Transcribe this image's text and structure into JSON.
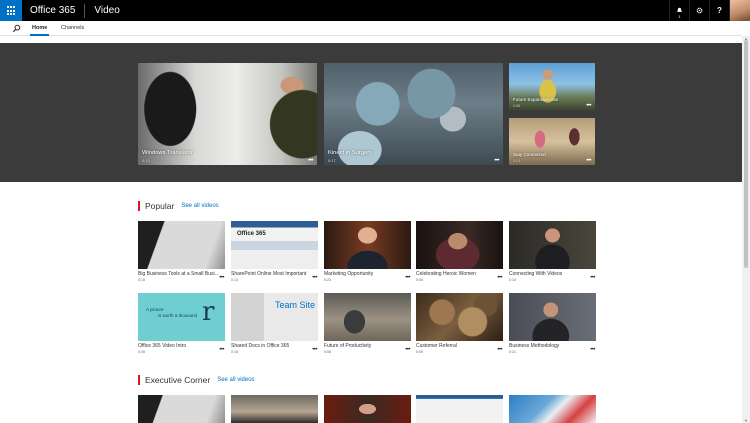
{
  "topbar": {
    "brand": "Office 365",
    "app": "Video",
    "notification_count": "1",
    "icons": [
      "app-launcher-icon",
      "bell-icon",
      "gear-icon",
      "help-icon"
    ],
    "accent_color": "#0072c6"
  },
  "nav": {
    "tabs": [
      {
        "label": "Home",
        "active": true
      },
      {
        "label": "Channels",
        "active": false
      }
    ]
  },
  "hero": [
    {
      "title": "Windows Translator",
      "duration": "0:13"
    },
    {
      "title": "Kinect in Surgery",
      "duration": "0:17"
    },
    {
      "title": "Future Expansion Site",
      "duration": "0:06"
    },
    {
      "title": "Stay Connected",
      "duration": "0:13"
    }
  ],
  "sections": [
    {
      "title": "Popular",
      "see_all": "See all videos",
      "videos": [
        {
          "title": "Big Business Tools at a Small Busi...",
          "duration": "0:15"
        },
        {
          "title": "SharePoint Online Most Important",
          "duration": "0:13"
        },
        {
          "title": "Marketing Opportunity",
          "duration": "0:23"
        },
        {
          "title": "Celebrating Heroic Women",
          "duration": "0:05"
        },
        {
          "title": "Connecting With Videos",
          "duration": "0:14"
        },
        {
          "title": "Office 365 Video Intro",
          "duration": "0:45"
        },
        {
          "title": "Shared Docs in Office 365",
          "duration": "0:15"
        },
        {
          "title": "Future of Productivity",
          "duration": "0:08"
        },
        {
          "title": "Customer Referral",
          "duration": "0:09"
        },
        {
          "title": "Business Methodology",
          "duration": "0:21"
        }
      ]
    },
    {
      "title": "Executive Corner",
      "see_all": "See all videos"
    }
  ],
  "thumb_text": {
    "intro_a": "A picture",
    "intro_b": "is worth a thousand",
    "intro_r": "r",
    "team_site": "Team Site",
    "o365": "Office 365"
  }
}
